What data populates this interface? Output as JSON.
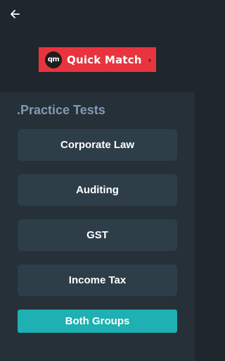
{
  "header": {
    "back_icon": "arrow-left-icon"
  },
  "quick_match": {
    "logo_text": "qm",
    "label": "Quick Match",
    "arrow": "›",
    "color": "#e8343f"
  },
  "practice": {
    "title": ".Practice Tests",
    "title_color": "#8498b0",
    "tests": [
      {
        "label": "Corporate Law"
      },
      {
        "label": "Auditing"
      },
      {
        "label": "GST"
      },
      {
        "label": "Income Tax"
      }
    ],
    "both_groups_label": "Both Groups",
    "accent": "#1eb0b2"
  }
}
